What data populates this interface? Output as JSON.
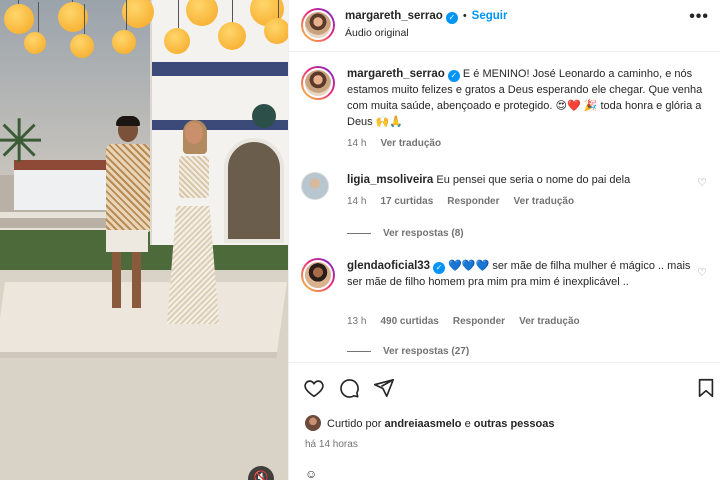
{
  "header": {
    "username": "margareth_serrao",
    "follow_label": "Seguir",
    "audio_label": "Áudio original",
    "more_label": "•••"
  },
  "caption": {
    "username": "margareth_serrao",
    "text": "E é MENINO! José Leonardo a caminho, e nós estamos muito felizes e gratos a Deus esperando ele chegar. Que venha com muita saúde, abençoado e protegido. 😍❤️ 🎉 toda honra e glória a Deus 🙌🙏",
    "time": "14 h",
    "translate_label": "Ver tradução"
  },
  "comments": [
    {
      "username": "ligia_msoliveira",
      "text": "Eu pensei que seria o nome do pai dela",
      "time": "14 h",
      "likes": "17 curtidas",
      "reply_label": "Responder",
      "translate_label": "Ver tradução",
      "replies_label": "Ver respostas (8)"
    },
    {
      "username": "glendaoficial33",
      "hearts": "💙💙💙",
      "text": "ser mãe de filha mulher é mágico .. mais ser mãe de filho homem pra mim pra mim é inexplicável ..",
      "time": "13 h",
      "likes": "490 curtidas",
      "reply_label": "Responder",
      "translate_label": "Ver tradução",
      "replies_label": "Ver respostas (27)"
    }
  ],
  "actions": {
    "liked_prefix": "Curtido por",
    "liked_user": "andreiaasmelo",
    "liked_conj": "e",
    "liked_others": "outras pessoas",
    "posted_time": "há 14 horas"
  },
  "icons": {
    "like": "heart-outline-icon",
    "comment": "comment-bubble-icon",
    "share": "paper-plane-icon",
    "save": "bookmark-icon",
    "more": "more-dots-icon",
    "verified": "verified-badge-icon",
    "audio": "speaker-icon"
  },
  "colors": {
    "link_blue": "#0095f6",
    "meta_gray": "#737373",
    "text": "#262626"
  }
}
